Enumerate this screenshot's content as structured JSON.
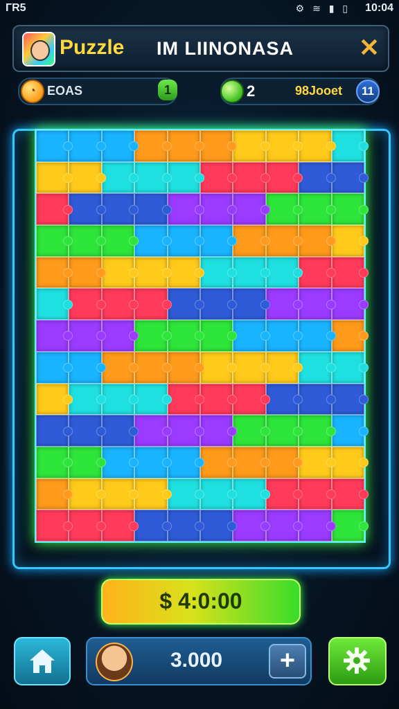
{
  "status_bar": {
    "carrier": "ГR5",
    "icons": "⚙ ≋ ▮ ▯",
    "time": "10:04"
  },
  "header": {
    "app_title": "Puzzle",
    "puzzle_name": "IM LIINONASA",
    "close_label": "✕"
  },
  "stats": {
    "left": {
      "icon": "coin-icon",
      "label": "EOAS",
      "badge": "1"
    },
    "right": {
      "icon": "gem-icon",
      "count": "2",
      "label": "98Jooet",
      "badge": "11"
    }
  },
  "board": {
    "columns": 10,
    "rows": 13,
    "palette": [
      "#19b4ff",
      "#2f5bd8",
      "#ffca1a",
      "#2ee53a",
      "#ff3a5a",
      "#ff9a1a",
      "#9a3bff",
      "#1fe0e0"
    ]
  },
  "price_button": {
    "label": "$ 4:0:00"
  },
  "bottom": {
    "home": "home-icon",
    "coins": "3.000",
    "plus_label": "+",
    "settings": "gear-icon"
  }
}
